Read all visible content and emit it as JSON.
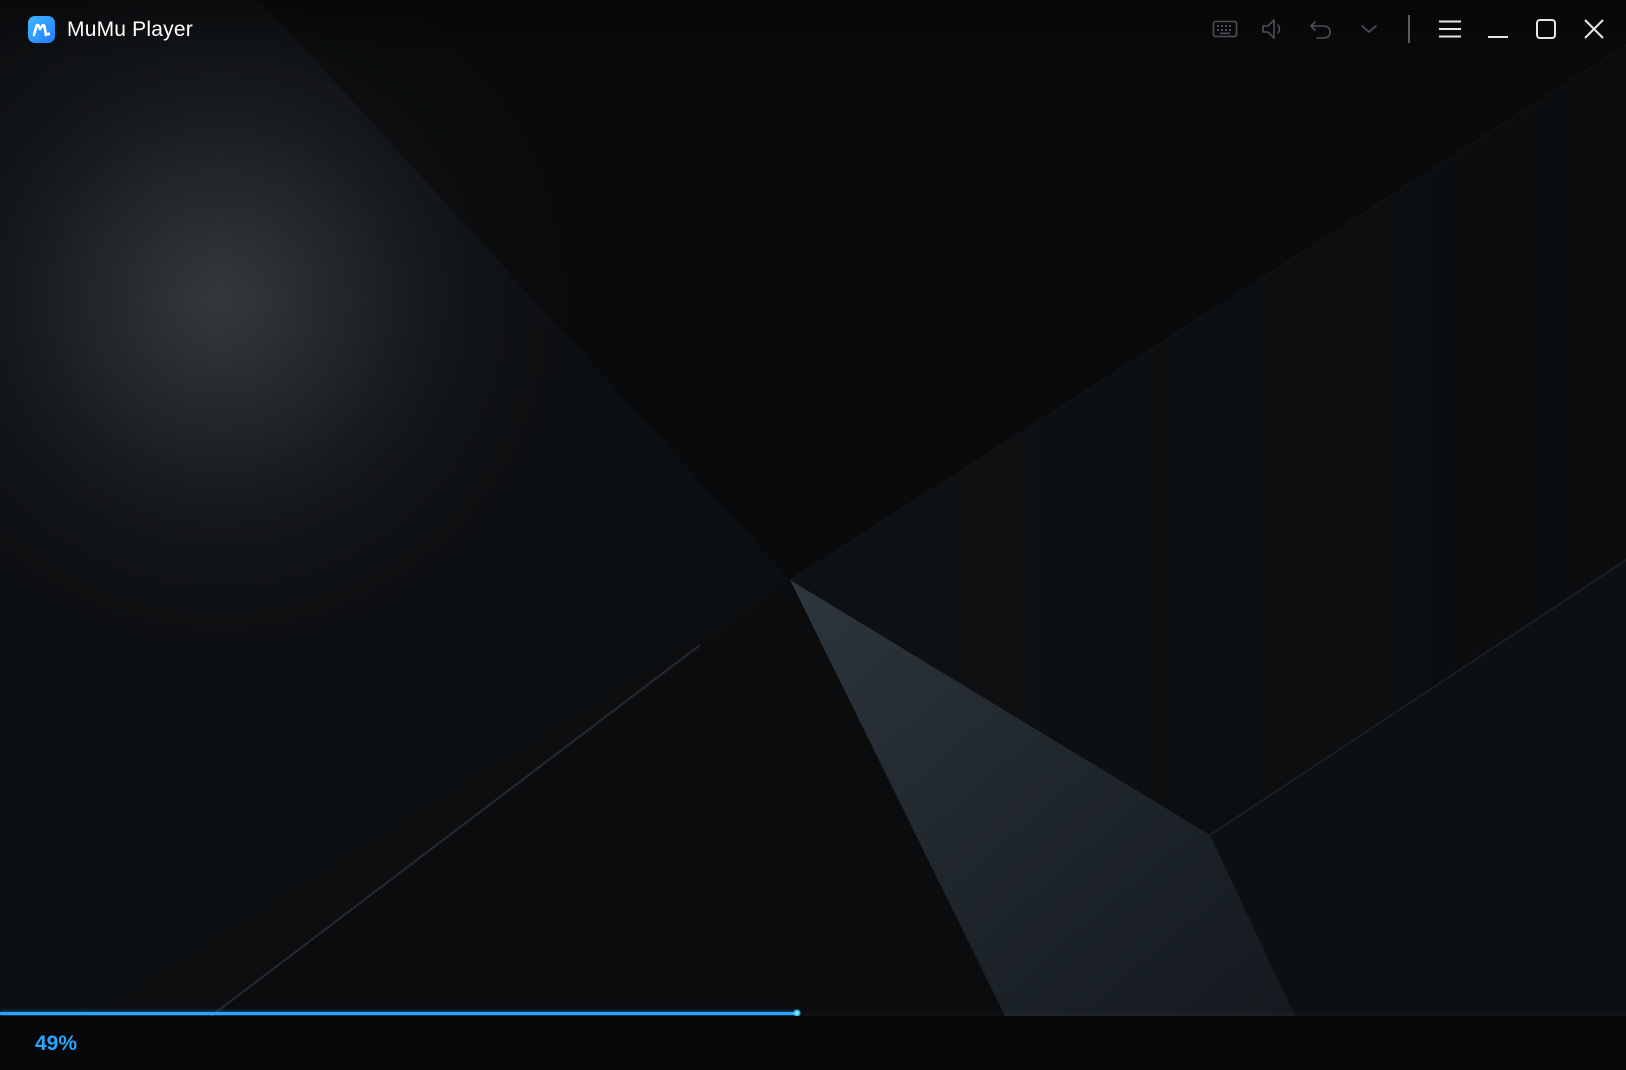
{
  "window": {
    "title": "MuMu Player",
    "logo_icon": "mumu-logo-icon",
    "accent_color": "#2aa6ff"
  },
  "toolbar": {
    "items": [
      {
        "icon": "keyboard-icon",
        "name": "keyboard-button"
      },
      {
        "icon": "volume-icon",
        "name": "volume-button"
      },
      {
        "icon": "undo-icon",
        "name": "back-button"
      },
      {
        "icon": "chevron-down-icon",
        "name": "more-button"
      },
      {
        "icon": "menu-icon",
        "name": "menu-button"
      },
      {
        "icon": "minimize-icon",
        "name": "minimize-button"
      },
      {
        "icon": "maximize-icon",
        "name": "maximize-button"
      },
      {
        "icon": "close-icon",
        "name": "close-button"
      }
    ]
  },
  "loading": {
    "progress_percent": 49,
    "progress_label": "49%",
    "progress_color": "#2aa6ff"
  }
}
